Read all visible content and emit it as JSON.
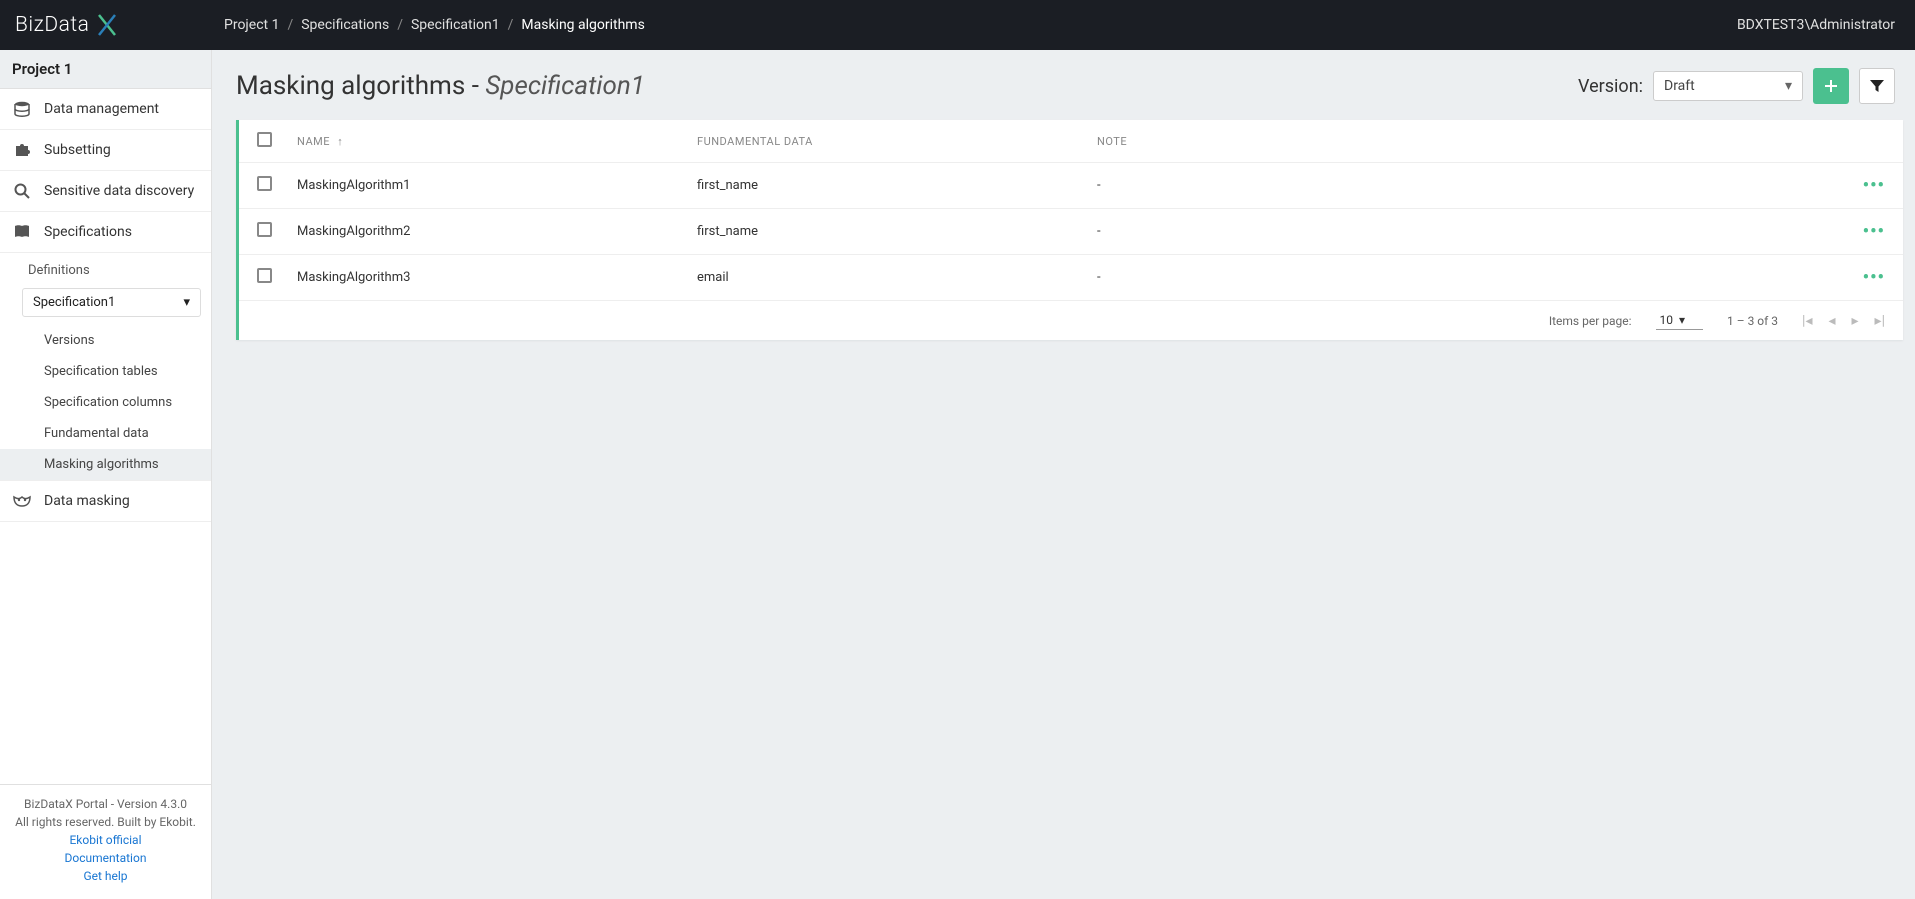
{
  "brand": "BizData",
  "user": "BDXTEST3\\Administrator",
  "breadcrumb": [
    "Project 1",
    "Specifications",
    "Specification1",
    "Masking algorithms"
  ],
  "sidebar": {
    "project": "Project 1",
    "items": {
      "data_mgmt": "Data management",
      "subsetting": "Subsetting",
      "sdd": "Sensitive data discovery",
      "specifications": "Specifications",
      "data_masking": "Data masking"
    },
    "definitions_label": "Definitions",
    "spec_selected": "Specification1",
    "sub_links": {
      "versions": "Versions",
      "spec_tables": "Specification tables",
      "spec_columns": "Specification columns",
      "fundamental": "Fundamental data",
      "masking_algs": "Masking algorithms"
    },
    "footer": {
      "line1": "BizDataX Portal - Version 4.3.0",
      "line2": "All rights reserved. Built by Ekobit.",
      "link1": "Ekobit official",
      "link2": "Documentation",
      "link3": "Get help"
    }
  },
  "page": {
    "title_prefix": "Masking algorithms - ",
    "title_em": "Specification1",
    "version_label": "Version:",
    "version_value": "Draft"
  },
  "table": {
    "headers": {
      "name": "NAME",
      "fund": "FUNDAMENTAL DATA",
      "note": "NOTE"
    },
    "rows": [
      {
        "name": "MaskingAlgorithm1",
        "fund": "first_name",
        "note": "-"
      },
      {
        "name": "MaskingAlgorithm2",
        "fund": "first_name",
        "note": "-"
      },
      {
        "name": "MaskingAlgorithm3",
        "fund": "email",
        "note": "-"
      }
    ],
    "footer": {
      "ipp_label": "Items per page:",
      "ipp_value": "10",
      "range": "1 – 3 of 3"
    }
  }
}
